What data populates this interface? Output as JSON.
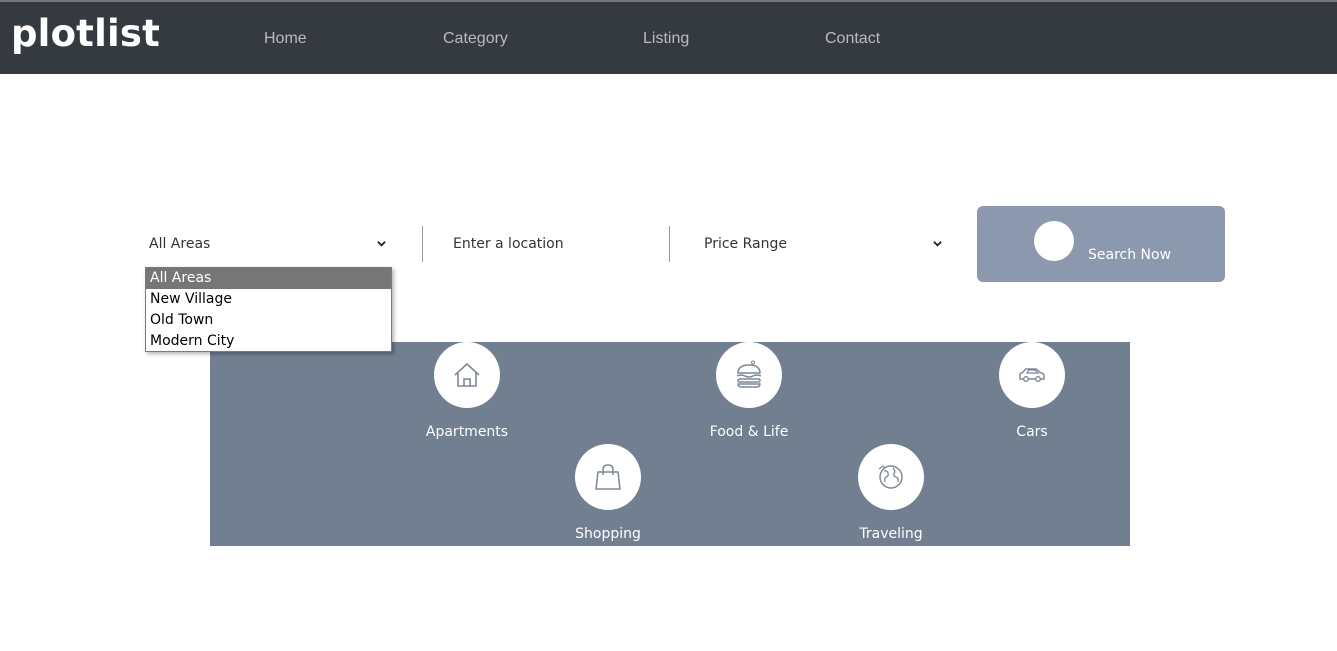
{
  "brand": {
    "name": "plotlist"
  },
  "nav": {
    "items": [
      {
        "label": "Home"
      },
      {
        "label": "Category"
      },
      {
        "label": "Listing"
      },
      {
        "label": "Contact"
      }
    ]
  },
  "search": {
    "area_select": {
      "value": "All Areas",
      "options": [
        "All Areas",
        "New Village",
        "Old Town",
        "Modern City"
      ],
      "selected_index": 0,
      "expanded": true
    },
    "location_input": {
      "placeholder": "Enter a location",
      "value": ""
    },
    "price_select": {
      "value": "Price Range"
    },
    "button_label": "Search Now"
  },
  "categories": [
    {
      "label": "Apartments",
      "icon": "house-icon"
    },
    {
      "label": "Food & Life",
      "icon": "burger-icon"
    },
    {
      "label": "Cars",
      "icon": "car-icon"
    },
    {
      "label": "Shopping",
      "icon": "shopping-bag-icon"
    },
    {
      "label": "Traveling",
      "icon": "globe-icon"
    }
  ],
  "colors": {
    "header_bg": "#343a40",
    "nav_text": "#b8bcc1",
    "search_button_bg": "#8c98ae",
    "category_panel_bg": "#717f90",
    "dropdown_selected_bg": "#767676"
  }
}
